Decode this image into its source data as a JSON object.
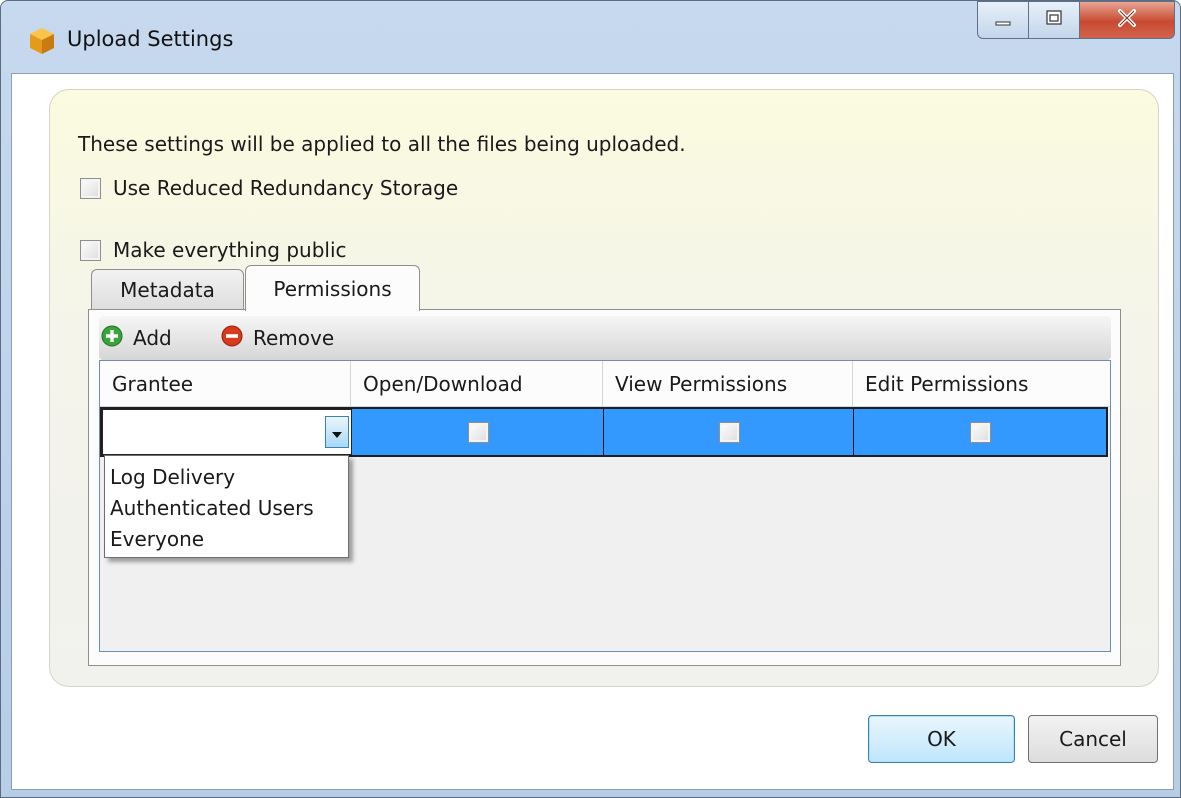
{
  "window": {
    "title": "Upload Settings",
    "icons": {
      "app": "aws-cube-icon",
      "minimize": "minimize-icon",
      "maximize": "maximize-icon",
      "close": "close-icon"
    }
  },
  "settings": {
    "intro": "These settings will be applied to all the files being uploaded.",
    "reduced_redundancy": {
      "label": "Use Reduced Redundancy Storage",
      "checked": false
    },
    "make_public": {
      "label": "Make everything public",
      "checked": false
    }
  },
  "tabs": [
    {
      "label": "Metadata",
      "active": false
    },
    {
      "label": "Permissions",
      "active": true
    }
  ],
  "toolbar": {
    "add_label": "Add",
    "remove_label": "Remove"
  },
  "grid": {
    "columns": [
      "Grantee",
      "Open/Download",
      "View Permissions",
      "Edit Permissions"
    ],
    "rows": [
      {
        "grantee": "",
        "open_download": false,
        "view_permissions": false,
        "edit_permissions": false,
        "selected": true
      }
    ]
  },
  "grantee_options": [
    "Log Delivery",
    "Authenticated Users",
    "Everyone"
  ],
  "buttons": {
    "ok": "OK",
    "cancel": "Cancel"
  },
  "colors": {
    "selection": "#3399ff",
    "panel": "#fbfbdf",
    "add_icon": "#3aa33a",
    "remove_icon": "#d93a1e"
  }
}
